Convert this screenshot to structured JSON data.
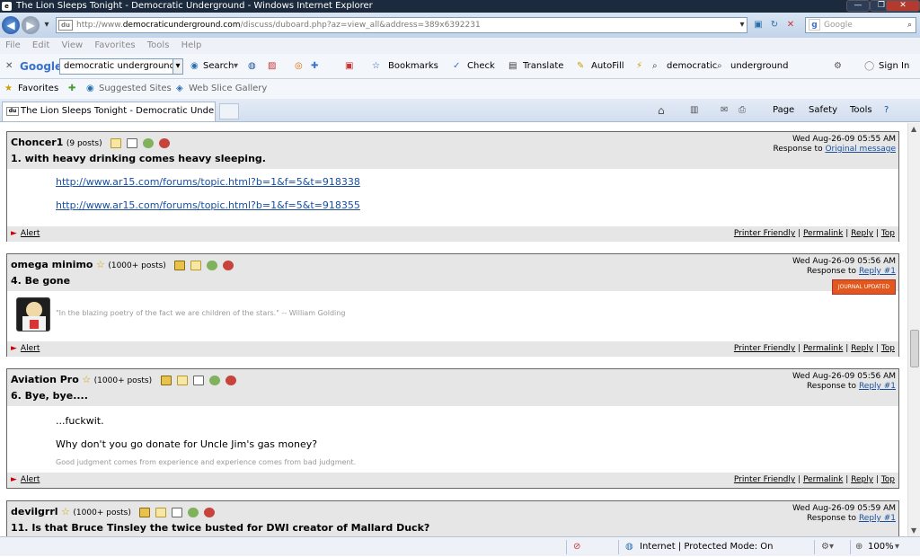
{
  "window": {
    "title": "The Lion Sleeps Tonight - Democratic Underground - Windows Internet Explorer",
    "ctl_min": "—",
    "ctl_max": "❐",
    "ctl_close": "✕"
  },
  "address": {
    "prefix": "http://www.",
    "domain": "democraticunderground.com",
    "path": "/discuss/duboard.php?az=view_all&address=389x6392231",
    "favicon": "du"
  },
  "search_box": {
    "placeholder": "Google"
  },
  "menu": [
    "File",
    "Edit",
    "View",
    "Favorites",
    "Tools",
    "Help"
  ],
  "google_bar": {
    "logo": "Google",
    "query": "democratic underground",
    "search": "Search",
    "bookmarks": "Bookmarks",
    "check": "Check",
    "translate": "Translate",
    "autofill": "AutoFill",
    "term1": "democratic",
    "term2": "underground",
    "signin": "Sign In"
  },
  "favorites_bar": {
    "favorites": "Favorites",
    "suggested": "Suggested Sites",
    "webslice": "Web Slice Gallery"
  },
  "tab": {
    "title": "The Lion Sleeps Tonight - Democratic Undergrou...",
    "favicon": "du"
  },
  "command_bar": {
    "page": "Page",
    "safety": "Safety",
    "tools": "Tools"
  },
  "posts": [
    {
      "author": "Choncer1",
      "posts": "(9 posts)",
      "star": false,
      "subject": "1. with heavy drinking comes heavy sleeping.",
      "date": "Wed Aug-26-09 05:55 AM",
      "response_label": "Response to",
      "response_link": "Original message",
      "lines": [
        "http://www.ar15.com/forums/topic.html?b=1&f=5&t=918338",
        "http://www.ar15.com/forums/topic.html?b=1&f=5&t=918355"
      ],
      "sig": ""
    },
    {
      "author": "omega minimo",
      "posts": "(1000+ posts)",
      "star": true,
      "subject": "4. Be gone",
      "date": "Wed Aug-26-09 05:56 AM",
      "response_label": "Response to",
      "response_link": "Reply #1",
      "badge": "JOURNAL UPDATED",
      "lines": [],
      "sig": "\"In the blazing poetry of the fact we are children of the stars.\" -- William Golding"
    },
    {
      "author": "Aviation Pro",
      "posts": "(1000+ posts)",
      "star": true,
      "subject": "6. Bye, bye....",
      "date": "Wed Aug-26-09 05:56 AM",
      "response_label": "Response to",
      "response_link": "Reply #1",
      "lines": [
        "...fuckwit.",
        "Why don't you go donate for Uncle Jim's gas money?"
      ],
      "sig": "Good judgment comes from experience and experience comes from bad judgment."
    },
    {
      "author": "devilgrrl",
      "posts": "(1000+ posts)",
      "star": true,
      "subject": "11. Is that Bruce Tinsley the twice busted for DWI creator of Mallard Duck?",
      "date": "Wed Aug-26-09 05:59 AM",
      "response_label": "Response to",
      "response_link": "Reply #1",
      "lines": [],
      "sig": ""
    }
  ],
  "footer": {
    "alert": "Alert",
    "printer": "Printer Friendly",
    "permalink": "Permalink",
    "reply": "Reply",
    "top": "Top"
  },
  "status_bar": {
    "zone": "Internet | Protected Mode: On",
    "zoom": "100%"
  }
}
